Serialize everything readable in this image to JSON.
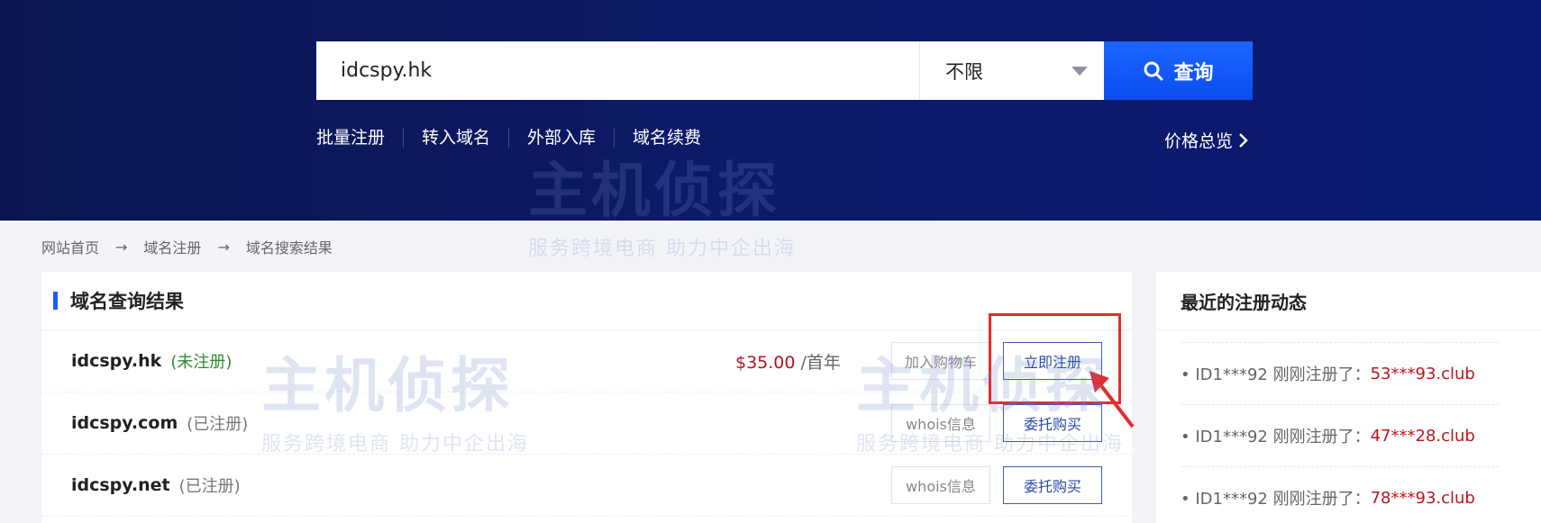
{
  "search": {
    "query": "idcspy.hk",
    "filter": "不限",
    "button": "查询"
  },
  "quick_links": [
    "批量注册",
    "转入域名",
    "外部入库",
    "域名续费"
  ],
  "price_overview": "价格总览",
  "breadcrumb": [
    "网站首页",
    "域名注册",
    "域名搜索结果"
  ],
  "breadcrumb_sep": "→",
  "results": {
    "title": "域名查询结果",
    "rows": [
      {
        "domain": "idcspy.hk",
        "status": "(未注册)",
        "price": "$35.00",
        "unit": "/首年",
        "btn1": "加入购物车",
        "btn2": "立即注册"
      },
      {
        "domain": "idcspy.com",
        "status": "(已注册)",
        "btn1": "whois信息",
        "btn2": "委托购买"
      },
      {
        "domain": "idcspy.net",
        "status": "(已注册)",
        "btn1": "whois信息",
        "btn2": "委托购买"
      }
    ]
  },
  "recent": {
    "title": "最近的注册动态",
    "items": [
      {
        "user": "• ID1***92 刚刚注册了：",
        "domain": "53***93.club"
      },
      {
        "user": "• ID1***92 刚刚注册了：",
        "domain": "47***28.club"
      },
      {
        "user": "• ID1***92 刚刚注册了：",
        "domain": "78***93.club"
      }
    ]
  },
  "watermark": {
    "text": "主机侦探",
    "sub": "服务跨境电商 助力中企出海"
  },
  "colors": {
    "accent": "#1c5bff",
    "price": "#b4121e",
    "available": "#2e8b2e",
    "highlight": "#e52b2b"
  }
}
